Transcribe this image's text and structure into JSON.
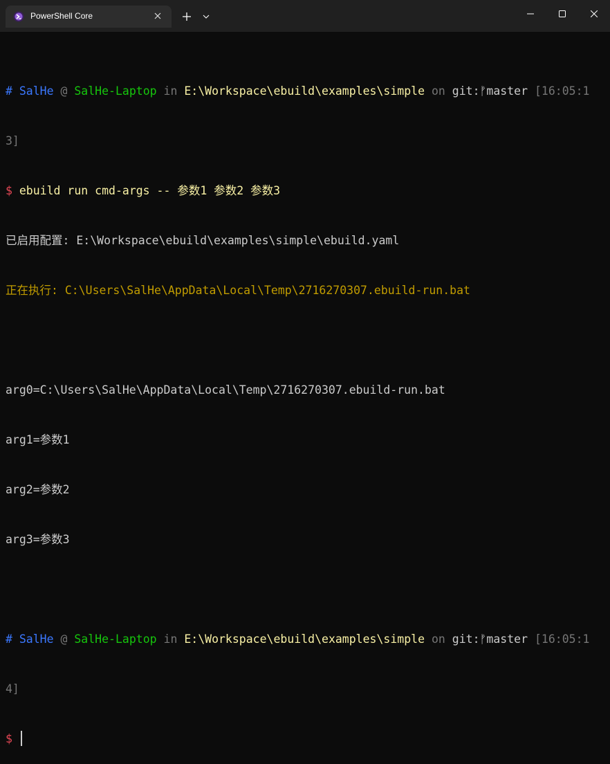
{
  "tab": {
    "title": "PowerShell Core",
    "icon": "powershell-icon"
  },
  "titlebar": {
    "new_tab_icon": "plus-icon",
    "dropdown_icon": "chevron-down-icon",
    "minimize_icon": "minimize-icon",
    "maximize_icon": "maximize-icon",
    "close_icon": "close-icon"
  },
  "colors": {
    "background": "#0c0c0c",
    "titlebar": "#202020",
    "tab": "#2d2d2d",
    "user": "#3b78ff",
    "host": "#16c60c",
    "path": "#f9f1a5",
    "info": "#c19c00",
    "prompt": "#e74856"
  },
  "terminal": {
    "prompt1": {
      "hash": "#",
      "user": "SalHe",
      "at": "@",
      "host": "SalHe-Laptop",
      "in": "in",
      "path": "E:\\Workspace\\ebuild\\examples\\simple",
      "on": "on",
      "git": "git:",
      "branch_icon": "branch-icon",
      "branch": "master",
      "time_a": "[16:05:1",
      "time_b": "3]"
    },
    "command": {
      "dollar": "$",
      "text": "ebuild run cmd-args -- 参数1 参数2 参数3"
    },
    "config_line": "已启用配置: E:\\Workspace\\ebuild\\examples\\simple\\ebuild.yaml",
    "exec_line": "正在执行: C:\\Users\\SalHe\\AppData\\Local\\Temp\\2716270307.ebuild-run.bat",
    "output": [
      "arg0=C:\\Users\\SalHe\\AppData\\Local\\Temp\\2716270307.ebuild-run.bat",
      "arg1=参数1",
      "arg2=参数2",
      "arg3=参数3"
    ],
    "prompt2": {
      "hash": "#",
      "user": "SalHe",
      "at": "@",
      "host": "SalHe-Laptop",
      "in": "in",
      "path": "E:\\Workspace\\ebuild\\examples\\simple",
      "on": "on",
      "git": "git:",
      "branch_icon": "branch-icon",
      "branch": "master",
      "time_a": "[16:05:1",
      "time_b": "4]"
    },
    "final_prompt": "$"
  }
}
